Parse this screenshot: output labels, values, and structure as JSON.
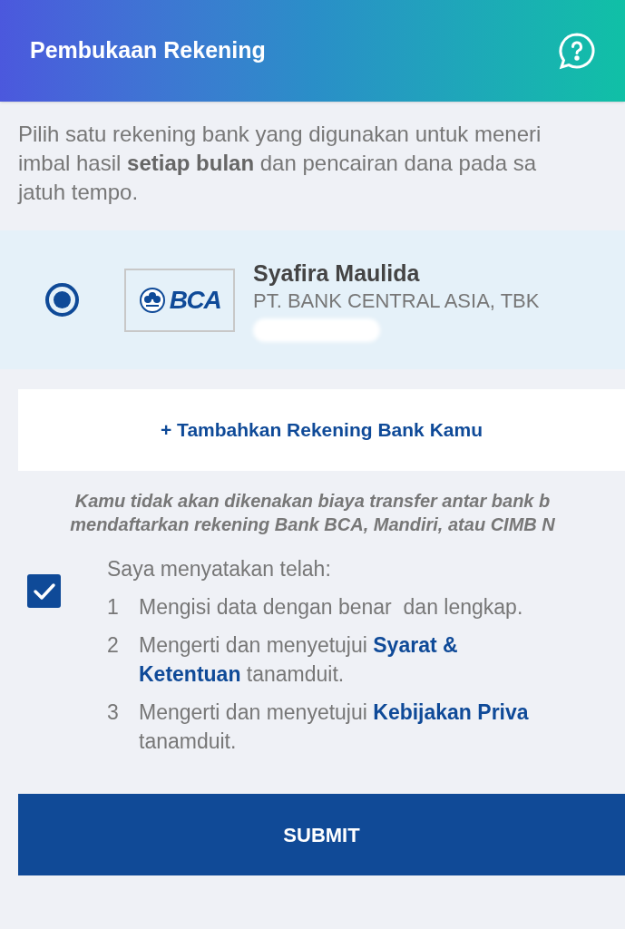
{
  "header": {
    "title": "Pembukaan Rekening"
  },
  "intro": [
    "Pilih satu rekening bank yang digunakan untuk meneri",
    "imbal hasil **setiap bulan** dan pencairan dana pada sa",
    "jatuh tempo."
  ],
  "accounts": [
    {
      "selected": true,
      "logo_text": "BCA",
      "name": "Syafira Maulida",
      "bank": "PT. BANK CENTRAL ASIA, TBK"
    }
  ],
  "add_button": "+ Tambahkan Rekening Bank Kamu",
  "note": [
    "Kamu tidak akan dikenakan biaya transfer antar bank b",
    "mendaftarkan rekening Bank BCA, Mandiri, atau CIMB N"
  ],
  "agreement": {
    "checked": true,
    "heading": "Saya menyatakan telah:",
    "items": [
      {
        "number": "1",
        "lines": [
          "Mengisi data dengan benar  dan lengkap."
        ]
      },
      {
        "number": "2",
        "lines": [
          "Mengerti dan menyetujui **Syarat &**",
          "**Ketentuan** tanamduit."
        ]
      },
      {
        "number": "3",
        "lines": [
          "Mengerti dan menyetujui **Kebijakan Priva**",
          "tanamduit."
        ]
      }
    ]
  },
  "submit": "SUBMIT"
}
